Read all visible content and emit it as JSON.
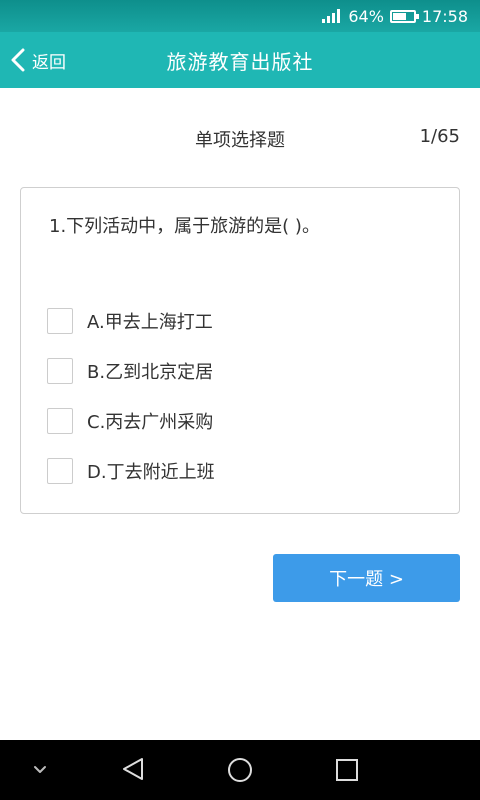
{
  "status_bar": {
    "battery_percent": "64%",
    "battery_level": 0.64,
    "time": "17:58"
  },
  "app_bar": {
    "back_label": "返回",
    "title": "旅游教育出版社"
  },
  "quiz": {
    "type_label": "单项选择题",
    "progress": "1/65",
    "question": "1.下列活动中，属于旅游的是(        )。",
    "options": [
      {
        "label": "A.甲去上海打工",
        "checked": false
      },
      {
        "label": "B.乙到北京定居",
        "checked": false
      },
      {
        "label": "C.丙去广州采购",
        "checked": false
      },
      {
        "label": "D.丁去附近上班",
        "checked": false
      }
    ],
    "next_label": "下一题 >"
  },
  "nav_bar": {
    "icons": [
      "chevron-down-icon",
      "back-triangle-icon",
      "home-circle-icon",
      "recents-square-icon"
    ]
  },
  "colors": {
    "app_bar": "#1fb7b4",
    "status_bar": "#0e8f8c",
    "button": "#3d9be9",
    "text": "#333333"
  }
}
